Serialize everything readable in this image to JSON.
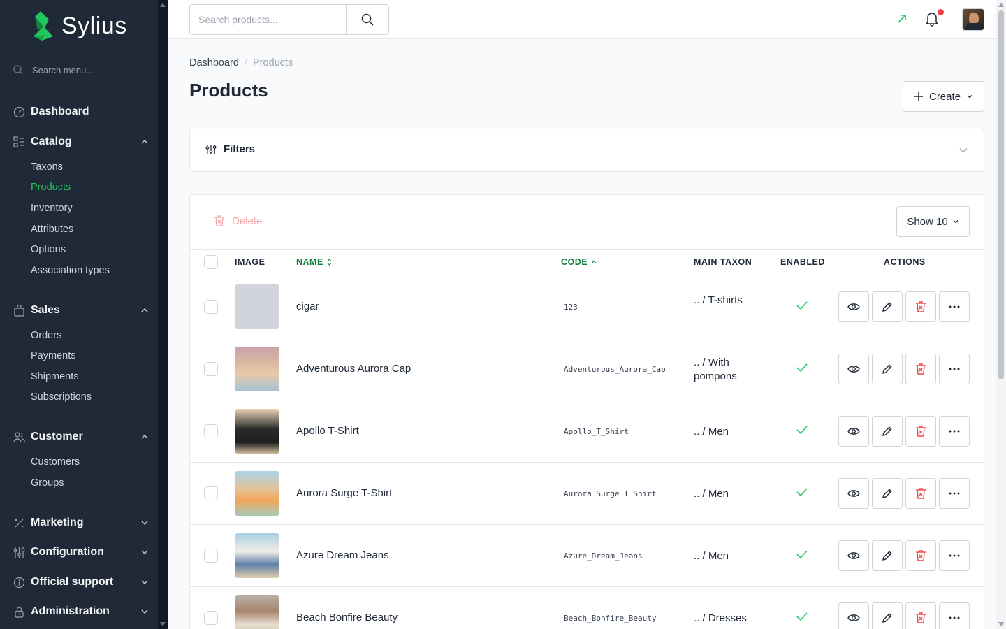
{
  "brand": {
    "name": "Sylius",
    "accent": "#22c55e"
  },
  "sidebar": {
    "search_placeholder": "Search menu...",
    "dashboard": "Dashboard",
    "catalog": {
      "label": "Catalog",
      "items": [
        "Taxons",
        "Products",
        "Inventory",
        "Attributes",
        "Options",
        "Association types"
      ]
    },
    "sales": {
      "label": "Sales",
      "items": [
        "Orders",
        "Payments",
        "Shipments",
        "Subscriptions"
      ]
    },
    "customer": {
      "label": "Customer",
      "items": [
        "Customers",
        "Groups"
      ]
    },
    "marketing": "Marketing",
    "configuration": "Configuration",
    "official_support": "Official support",
    "administration": "Administration"
  },
  "topbar": {
    "search_placeholder": "Search products..."
  },
  "breadcrumb": {
    "home": "Dashboard",
    "separator": "/",
    "current": "Products"
  },
  "page": {
    "title": "Products",
    "create_label": "Create"
  },
  "filters": {
    "label": "Filters"
  },
  "toolbar": {
    "delete_label": "Delete",
    "show_label": "Show 10"
  },
  "table": {
    "columns": {
      "image": "IMAGE",
      "name": "NAME",
      "code": "CODE",
      "main_taxon": "MAIN TAXON",
      "enabled": "ENABLED",
      "actions": "ACTIONS"
    },
    "rows": [
      {
        "name": "cigar",
        "code": "123",
        "taxon": ".. / T-shirts",
        "enabled": true
      },
      {
        "name": "Adventurous Aurora Cap",
        "code": "Adventurous_Aurora_Cap",
        "taxon": ".. / With pompons",
        "enabled": true
      },
      {
        "name": "Apollo T-Shirt",
        "code": "Apollo_T_Shirt",
        "taxon": ".. / Men",
        "enabled": true
      },
      {
        "name": "Aurora Surge T-Shirt",
        "code": "Aurora_Surge_T_Shirt",
        "taxon": ".. / Men",
        "enabled": true
      },
      {
        "name": "Azure Dream Jeans",
        "code": "Azure_Dream_Jeans",
        "taxon": ".. / Men",
        "enabled": true
      },
      {
        "name": "Beach Bonfire Beauty",
        "code": "Beach_Bonfire_Beauty",
        "taxon": ".. / Dresses",
        "enabled": true
      }
    ]
  }
}
